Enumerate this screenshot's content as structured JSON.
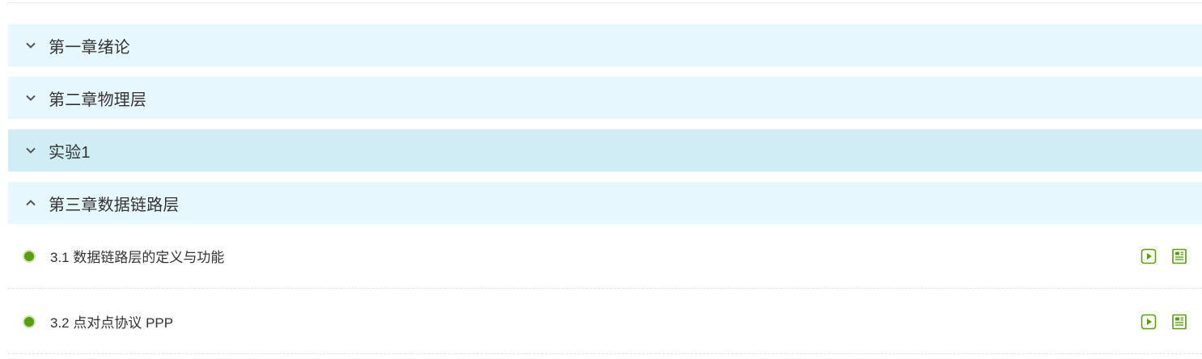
{
  "colors": {
    "chapter_bg": "#e6f7fd",
    "chapter_hover_bg": "#d0edf6",
    "accent_green": "#5a9e0f",
    "text": "#333333"
  },
  "chapters": [
    {
      "title": "第一章绪论",
      "expanded": false,
      "chevron": "chevron-down-icon"
    },
    {
      "title": "第二章物理层",
      "expanded": false,
      "chevron": "chevron-down-icon"
    },
    {
      "title": "实验1",
      "expanded": false,
      "chevron": "chevron-down-icon",
      "hovered": true
    },
    {
      "title": "第三章数据链路层",
      "expanded": true,
      "chevron": "chevron-up-icon"
    }
  ],
  "lessons": [
    {
      "title": "3.1 数据链路层的定义与功能",
      "status": "completed",
      "icons": [
        "play-video-icon",
        "document-icon"
      ]
    },
    {
      "title": "3.2 点对点协议 PPP",
      "status": "completed",
      "icons": [
        "play-video-icon",
        "document-icon"
      ]
    }
  ]
}
